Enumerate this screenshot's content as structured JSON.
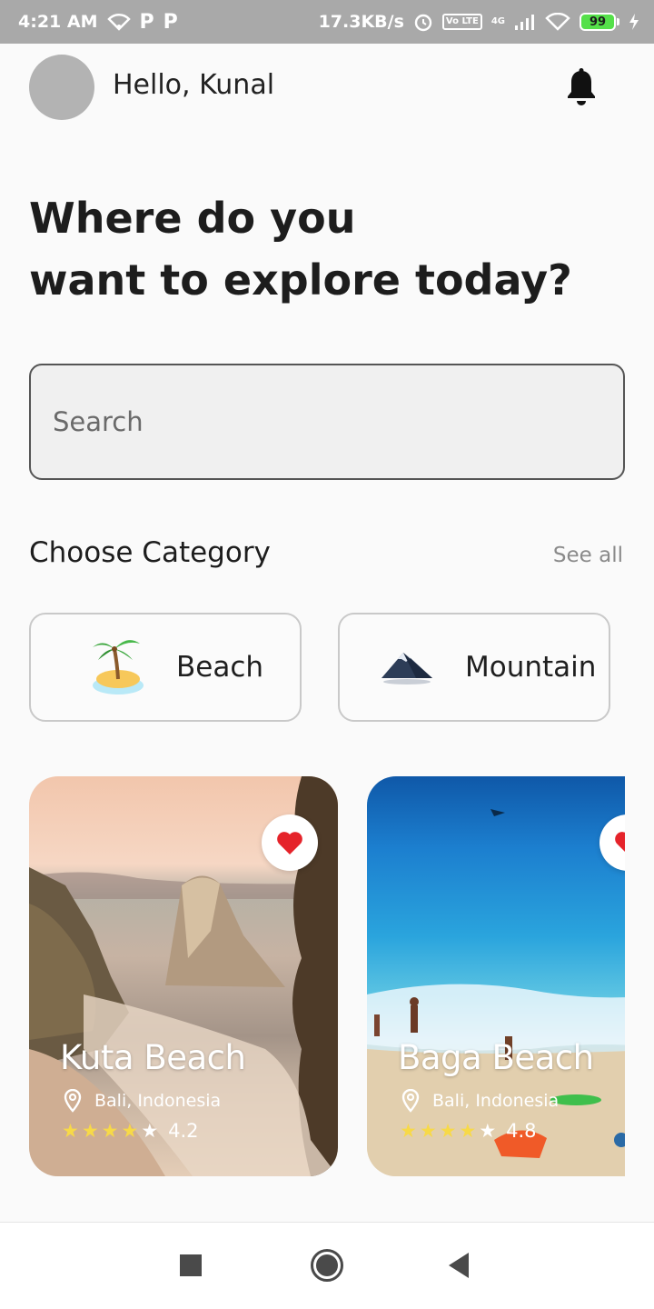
{
  "status_bar": {
    "time": "4:21 AM",
    "p1": "P",
    "p2": "P",
    "speed": "17.3KB/s",
    "lte": "Vo LTE",
    "network": "4G",
    "battery": "99"
  },
  "header": {
    "greeting": "Hello, Kunal",
    "notification_icon": "bell-icon"
  },
  "headline": {
    "line1": "Where do you",
    "line2": "want to explore today?"
  },
  "search": {
    "placeholder": "Search"
  },
  "categories_section": {
    "title": "Choose Category",
    "see_all": "See all",
    "items": [
      {
        "label": "Beach",
        "icon": "beach-island-icon"
      },
      {
        "label": "Mountain",
        "icon": "mountain-icon"
      }
    ]
  },
  "places": [
    {
      "name": "Kuta Beach",
      "location": "Bali, Indonesia",
      "rating": "4.2",
      "stars_filled": 4,
      "favorite": true
    },
    {
      "name": "Baga Beach",
      "location": "Bali, Indonesia",
      "rating": "4.8",
      "stars_filled": 4,
      "favorite": true
    }
  ],
  "colors": {
    "favorite": "#e5232a",
    "star": "#f7d948",
    "status_bar": "#a9a9a9",
    "battery": "#55e04a"
  },
  "nav_bar": {
    "recents_icon": "square-icon",
    "home_icon": "circle-home-icon",
    "back_icon": "triangle-back-icon"
  }
}
